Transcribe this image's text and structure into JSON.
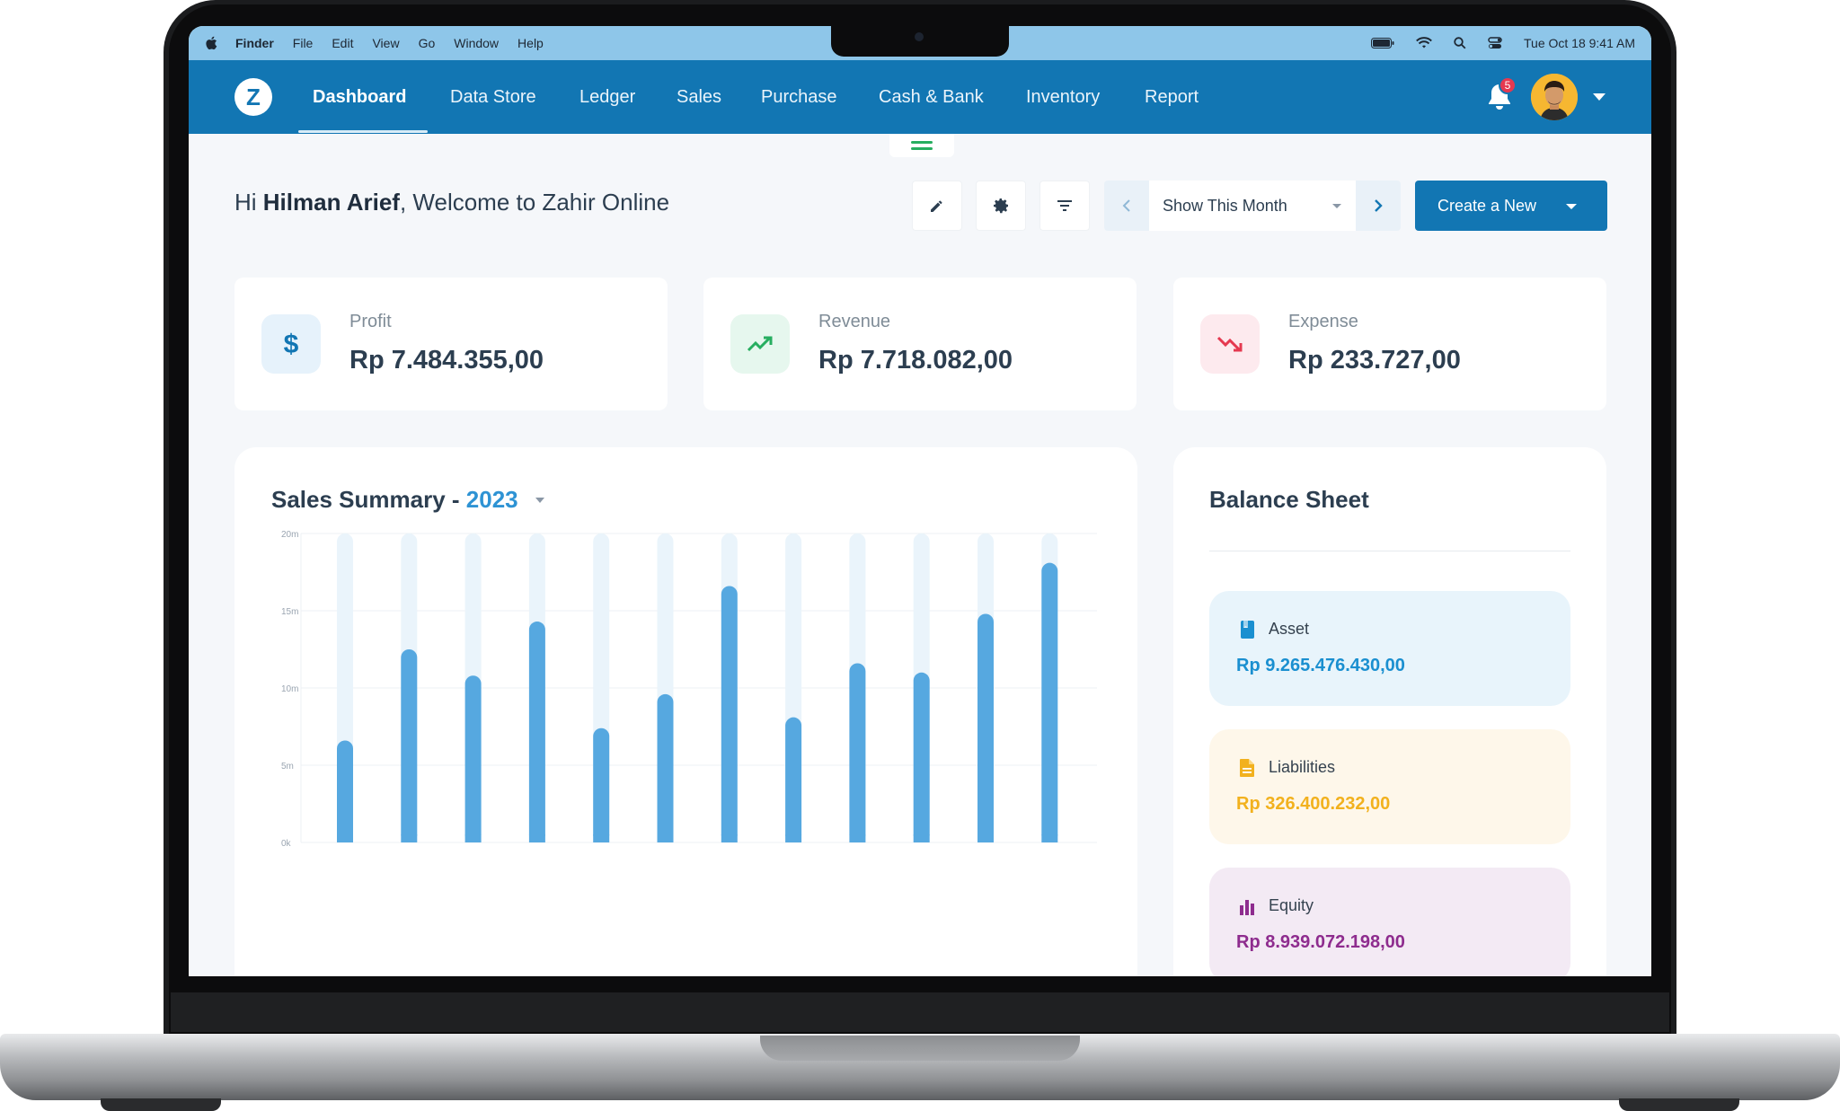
{
  "menubar": {
    "items": [
      "Finder",
      "File",
      "Edit",
      "View",
      "Go",
      "Window",
      "Help"
    ],
    "datetime": "Tue Oct 18  9:41 AM"
  },
  "nav": {
    "logo": "Z",
    "items": [
      "Dashboard",
      "Data Store",
      "Ledger",
      "Sales",
      "Purchase",
      "Cash & Bank",
      "Inventory",
      "Report"
    ],
    "active": "Dashboard",
    "notification_count": "5"
  },
  "header": {
    "greeting_prefix": "Hi ",
    "user_name": "Hilman Arief",
    "greeting_suffix": ", Welcome to Zahir Online",
    "period": "Show This Month",
    "create_label": "Create a New"
  },
  "stats": [
    {
      "label": "Profit",
      "value": "Rp 7.484.355,00",
      "icon": "dollar-icon",
      "color": "#1276b3",
      "bg": "#e6f2fb"
    },
    {
      "label": "Revenue",
      "value": "Rp 7.718.082,00",
      "icon": "trending-up-icon",
      "color": "#27ae60",
      "bg": "#e6f7ee"
    },
    {
      "label": "Expense",
      "value": "Rp 233.727,00",
      "icon": "trending-down-icon",
      "color": "#e53950",
      "bg": "#fdeaee"
    }
  ],
  "sales_summary": {
    "title": "Sales Summary - ",
    "year": "2023"
  },
  "chart_data": {
    "type": "bar",
    "title": "Sales Summary - 2023",
    "y_ticks": [
      "0k",
      "5m",
      "10m",
      "15m",
      "20m"
    ],
    "ylim": [
      0,
      20
    ],
    "values": [
      6.6,
      12.5,
      10.8,
      14.3,
      7.4,
      9.6,
      16.6,
      8.1,
      11.6,
      11.0,
      14.8,
      18.1
    ],
    "bar_color": "#56a8e0",
    "track_color": "#eaf4fb"
  },
  "balance_sheet": {
    "title": "Balance Sheet",
    "items": [
      {
        "label": "Asset",
        "value": "Rp 9.265.476.430,00",
        "icon": "book-icon",
        "color": "#1a8fd0",
        "bg": "#e8f4fb"
      },
      {
        "label": "Liabilities",
        "value": "Rp 326.400.232,00",
        "icon": "document-icon",
        "color": "#f2b11e",
        "bg": "#fef7ea"
      },
      {
        "label": "Equity",
        "value": "Rp 8.939.072.198,00",
        "icon": "bar-chart-icon",
        "color": "#8e2c8e",
        "bg": "#f3eaf4"
      }
    ]
  }
}
